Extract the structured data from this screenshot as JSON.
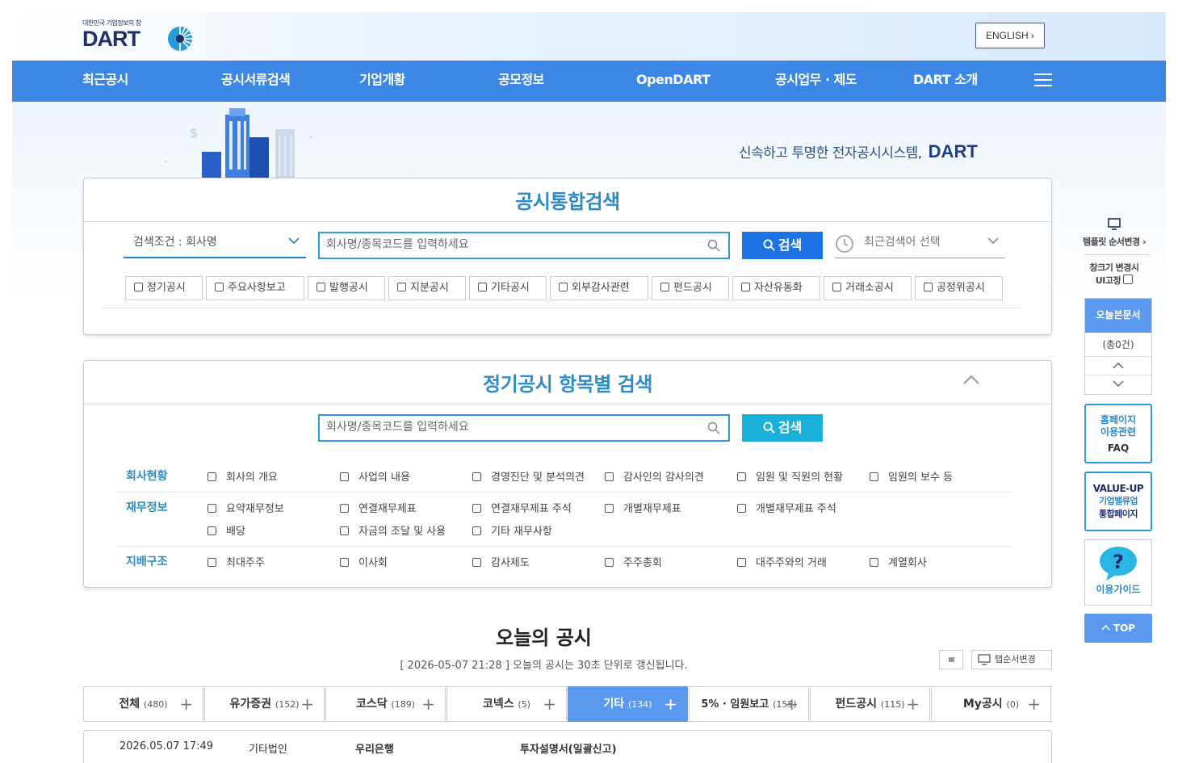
{
  "header": {
    "logo_sub": "대한민국 기업정보의 창",
    "logo_main": "DART",
    "english_label": "ENGLISH"
  },
  "nav": {
    "items": [
      "최근공시",
      "공시서류검색",
      "기업개황",
      "공모정보",
      "OpenDART",
      "공시업무 · 제도",
      "DART 소개"
    ]
  },
  "hero": {
    "slogan": "신속하고 투명한 전자공시시스템,",
    "slogan_brand": "DART"
  },
  "integrated_search": {
    "title": "공시통합검색",
    "condition_label": "검색조건 : 회사명",
    "search_placeholder": "회사명/종목코드를 입력하세요",
    "search_button": "검색",
    "recent_label": "최근검색어 선택",
    "types": [
      "정기공시",
      "주요사항보고",
      "발행공시",
      "지분공시",
      "기타공시",
      "외부감사관련",
      "펀드공시",
      "자산유동화",
      "거래소공시",
      "공정위공시"
    ]
  },
  "periodic_search": {
    "title": "정기공시 항목별 검색",
    "search_placeholder": "회사명/종목코드를 입력하세요",
    "search_button": "검색",
    "groups": [
      {
        "label": "회사현황",
        "items": [
          "회사의 개요",
          "사업의 내용",
          "경영진단 및 분석의견",
          "감사인의 감사의견",
          "임원 및 직원의 현황",
          "임원의 보수 등"
        ]
      },
      {
        "label": "재무정보",
        "items": [
          "요약재무정보",
          "연결재무제표",
          "연결재무제표 주석",
          "개별재무제표",
          "개별재무제표 주석",
          "배당",
          "자금의 조달 및 사용",
          "기타 재무사항"
        ]
      },
      {
        "label": "지배구조",
        "items": [
          "최대주주",
          "이사회",
          "감사제도",
          "주주총회",
          "대주주와의 거래",
          "계열회사"
        ]
      }
    ]
  },
  "today": {
    "title": "오늘의 공시",
    "notice": "[ 2026-05-07 21:28 ] 오늘의 공시는 30초 단위로 갱신됩니다.",
    "tab_order_label": "탭순서변경",
    "tabs": [
      {
        "label": "전체",
        "count": "(480)",
        "active": false
      },
      {
        "label": "유가증권",
        "count": "(152)",
        "active": false
      },
      {
        "label": "코스닥",
        "count": "(189)",
        "active": false
      },
      {
        "label": "코넥스",
        "count": "(5)",
        "active": false
      },
      {
        "label": "기타",
        "count": "(134)",
        "active": true
      },
      {
        "label": "5% · 임원보고",
        "count": "(155)",
        "active": false
      },
      {
        "label": "펀드공시",
        "count": "(115)",
        "active": false
      },
      {
        "label": "My공시",
        "count": "(0)",
        "active": false
      }
    ],
    "first_row": {
      "time": "2026.05.07 17:49",
      "market": "기타법인",
      "company": "우리은행",
      "report": "투자설명서(일괄신고)"
    }
  },
  "sidebar": {
    "template_label": "템플릿 순서변경",
    "window_label_1": "창크기 변경시",
    "window_label_2": "UI고정",
    "today_docs_label": "오늘본문서",
    "today_docs_count": "(총0건)",
    "faq_line1": "홈페이지",
    "faq_line2": "이용관련",
    "faq_line3": "FAQ",
    "value_line1": "VALUE-UP",
    "value_line2": "기업밸류업",
    "value_line3": "통합페이지",
    "guide_label": "이용가이드",
    "top_label": "TOP"
  },
  "colors": {
    "nav": "#3c86e6",
    "accent": "#2d8bc9",
    "button": "#1c73e6",
    "button2": "#19b0d9",
    "active_tab": "#5a99ee"
  }
}
